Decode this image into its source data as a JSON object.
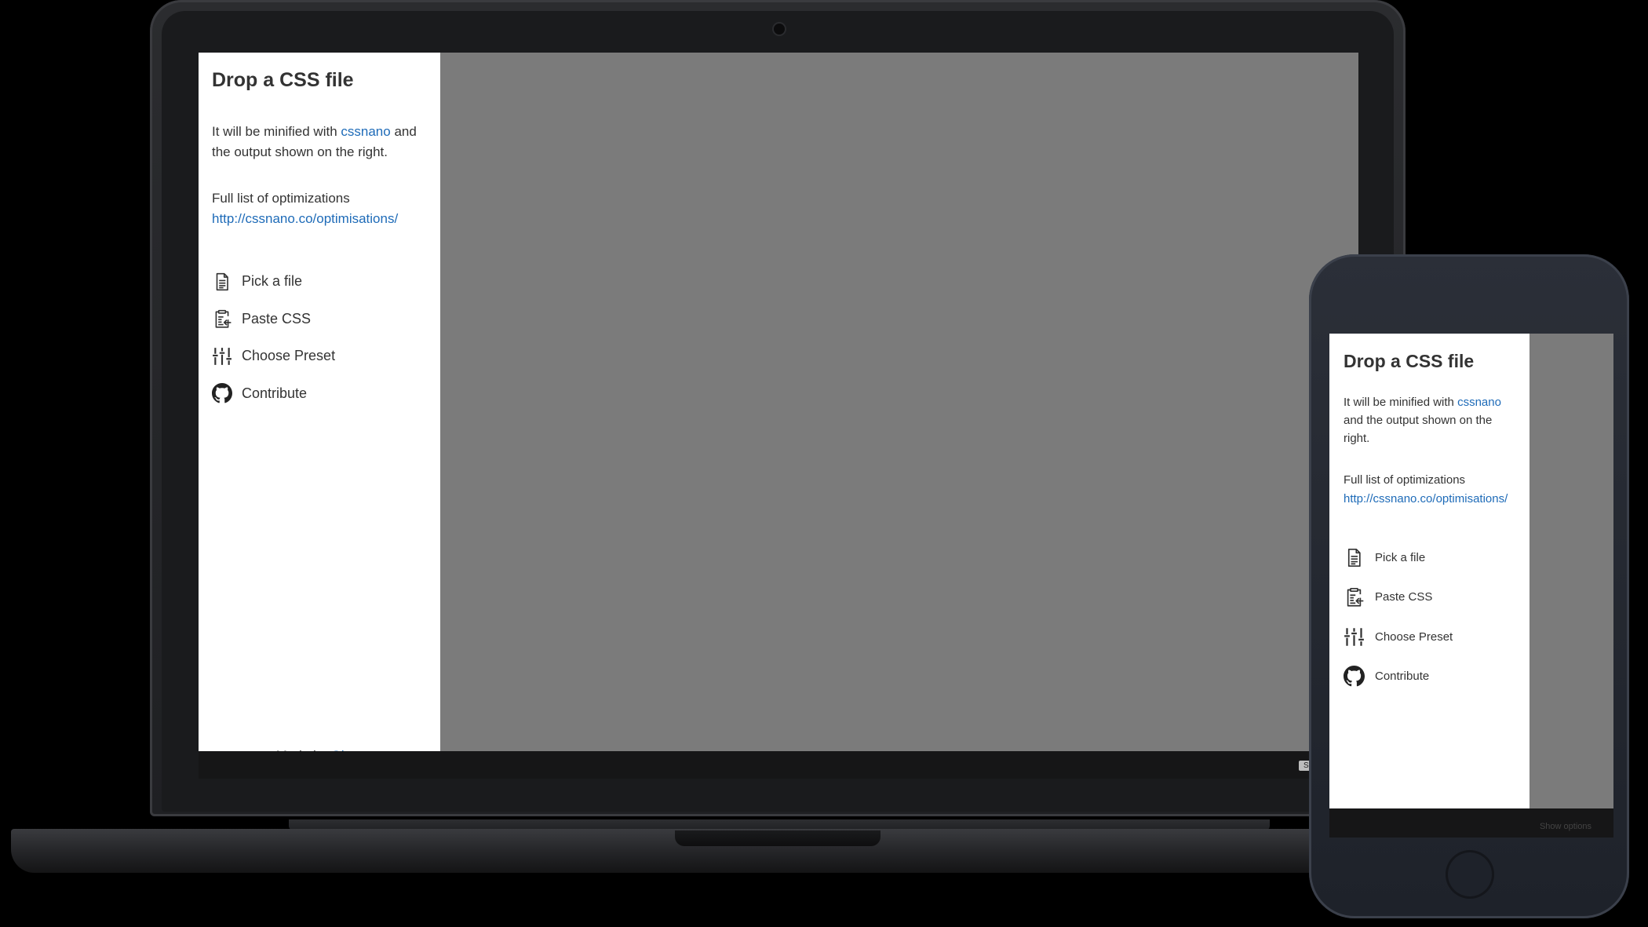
{
  "panel": {
    "title": "Drop a CSS file",
    "intro_before_link": "It will be minified with ",
    "intro_link": "cssnano",
    "intro_after_link": " and the output shown on the right.",
    "optimizations_label": "Full list of optimizations",
    "optimizations_link": "http://cssnano.co/optimisations/",
    "actions": [
      {
        "label": "Pick a file",
        "icon": "file-icon"
      },
      {
        "label": "Paste CSS",
        "icon": "clipboard-icon"
      },
      {
        "label": "Choose Preset",
        "icon": "sliders-icon"
      },
      {
        "label": "Contribute",
        "icon": "github-icon"
      }
    ],
    "footer_prefix": "Made by ",
    "footer_link": "Glen",
    "footer_suffix": "."
  },
  "output": {
    "show_options_label": "Show options"
  },
  "colors": {
    "link": "#1e6bb8",
    "output_background": "#7b7b7b",
    "panel_background": "#ffffff",
    "text": "#333333"
  }
}
